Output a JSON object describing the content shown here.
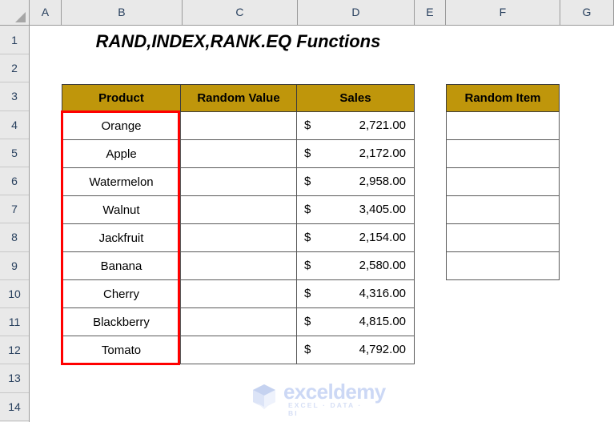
{
  "app": {
    "type": "spreadsheet",
    "corner_name": "select-all-corner"
  },
  "grid": {
    "column_headers": [
      "A",
      "B",
      "C",
      "D",
      "E",
      "F",
      "G"
    ],
    "row_headers": [
      "1",
      "2",
      "3",
      "4",
      "5",
      "6",
      "7",
      "8",
      "9",
      "10",
      "11",
      "12",
      "13",
      "14"
    ]
  },
  "title": {
    "text": "RAND,INDEX,RANK.EQ Functions"
  },
  "colors": {
    "header_fill": "#BF960B",
    "selection_outline": "#FF0000",
    "cell_border": "#595959",
    "grid_header_bg": "#E9E9E9",
    "watermark": "#CCD8F5"
  },
  "main_table": {
    "headers": [
      "Product",
      "Random Value",
      "Sales"
    ],
    "rows": [
      {
        "product": "Orange",
        "random_value": "",
        "currency": "$",
        "sales": "2,721.00"
      },
      {
        "product": "Apple",
        "random_value": "",
        "currency": "$",
        "sales": "2,172.00"
      },
      {
        "product": "Watermelon",
        "random_value": "",
        "currency": "$",
        "sales": "2,958.00"
      },
      {
        "product": "Walnut",
        "random_value": "",
        "currency": "$",
        "sales": "3,405.00"
      },
      {
        "product": "Jackfruit",
        "random_value": "",
        "currency": "$",
        "sales": "2,154.00"
      },
      {
        "product": "Banana",
        "random_value": "",
        "currency": "$",
        "sales": "2,580.00"
      },
      {
        "product": "Cherry",
        "random_value": "",
        "currency": "$",
        "sales": "4,316.00"
      },
      {
        "product": "Blackberry",
        "random_value": "",
        "currency": "$",
        "sales": "4,815.00"
      },
      {
        "product": "Tomato",
        "random_value": "",
        "currency": "$",
        "sales": "4,792.00"
      }
    ]
  },
  "item_table": {
    "header": "Random Item",
    "rows": [
      "",
      "",
      "",
      "",
      "",
      ""
    ]
  },
  "watermark": {
    "name": "exceldemy",
    "tagline": "EXCEL · DATA · BI"
  }
}
